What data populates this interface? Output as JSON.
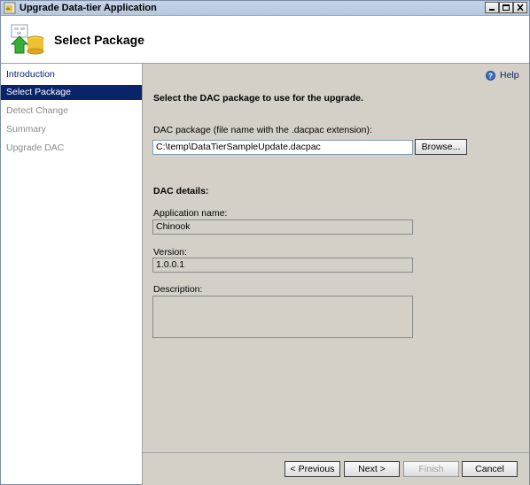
{
  "window": {
    "title": "Upgrade Data-tier Application",
    "controls": {
      "minimize": "minimize",
      "maximize": "maximize",
      "close": "close"
    }
  },
  "header": {
    "title": "Select Package"
  },
  "sidebar": {
    "items": [
      {
        "label": "Introduction",
        "state": "link"
      },
      {
        "label": "Select Package",
        "state": "active"
      },
      {
        "label": "Detect Change",
        "state": "disabled"
      },
      {
        "label": "Summary",
        "state": "disabled"
      },
      {
        "label": "Upgrade DAC",
        "state": "disabled"
      }
    ]
  },
  "help": {
    "label": "Help"
  },
  "main": {
    "instruction": "Select the DAC package to use for the upgrade.",
    "package_label": "DAC package (file name with the .dacpac extension):",
    "package_value": "C:\\temp\\DataTierSampleUpdate.dacpac",
    "browse_label": "Browse...",
    "details_heading": "DAC details:",
    "app_name_label": "Application name:",
    "app_name_value": "Chinook",
    "version_label": "Version:",
    "version_value": "1.0.0.1",
    "description_label": "Description:",
    "description_value": ""
  },
  "footer": {
    "previous": "< Previous",
    "next": "Next >",
    "finish": "Finish",
    "cancel": "Cancel"
  },
  "colors": {
    "active_nav": "#0a246a",
    "panel_bg": "#d4d0c8",
    "link": "#0a246a"
  }
}
